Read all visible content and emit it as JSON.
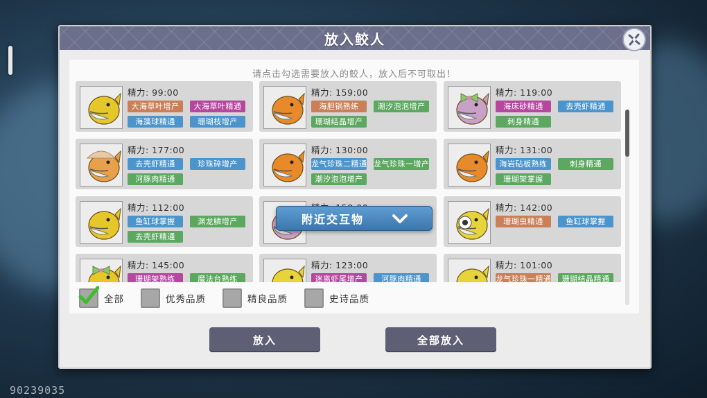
{
  "dialog": {
    "title": "放入鲛人",
    "hint": "请点击勾选需要放入的鲛人，放入后不可取出！"
  },
  "energy_label": "精力:",
  "cards": [
    {
      "energy": "99:00",
      "fish_color": "#e6c72a",
      "accessory": "none",
      "tags": [
        {
          "text": "大海草叶增产",
          "color": "orange"
        },
        {
          "text": "大海草叶精通",
          "color": "pink"
        },
        {
          "text": "海藻球精通",
          "color": "blue"
        },
        {
          "text": "珊瑚枝增产",
          "color": "blue"
        }
      ]
    },
    {
      "energy": "159:00",
      "fish_color": "#e88a2a",
      "accessory": "none",
      "tags": [
        {
          "text": "海胆锅熟练",
          "color": "orange"
        },
        {
          "text": "潮汐泡泡增产",
          "color": "green"
        },
        {
          "text": "珊瑚结晶增产",
          "color": "green"
        }
      ]
    },
    {
      "energy": "119:00",
      "fish_color": "#c8a0c8",
      "accessory": "bow",
      "tags": [
        {
          "text": "海床砂精通",
          "color": "pink"
        },
        {
          "text": "去壳虾精通",
          "color": "blue"
        },
        {
          "text": "刺身精通",
          "color": "green"
        }
      ]
    },
    {
      "energy": "177:00",
      "fish_color": "#e8a04a",
      "accessory": "shell",
      "tags": [
        {
          "text": "去壳虾精通",
          "color": "blue"
        },
        {
          "text": "珍珠碎增产",
          "color": "blue"
        },
        {
          "text": "河豚肉精通",
          "color": "green"
        }
      ]
    },
    {
      "energy": "130:00",
      "fish_color": "#e88a2a",
      "accessory": "none",
      "tags": [
        {
          "text": "龙气珍珠二精通",
          "color": "blue"
        },
        {
          "text": "龙气珍珠一增产",
          "color": "green"
        },
        {
          "text": "潮汐泡泡增产",
          "color": "green"
        }
      ]
    },
    {
      "energy": "131:00",
      "fish_color": "#e88a2a",
      "accessory": "none",
      "tags": [
        {
          "text": "海岩砧板熟练",
          "color": "blue"
        },
        {
          "text": "刺身精通",
          "color": "green"
        },
        {
          "text": "珊瑚架掌握",
          "color": "green"
        }
      ]
    },
    {
      "energy": "112:00",
      "fish_color": "#e6c72a",
      "accessory": "none",
      "tags": [
        {
          "text": "鱼缸球掌握",
          "color": "blue"
        },
        {
          "text": "渊龙鳞增产",
          "color": "green"
        },
        {
          "text": "去壳虾精通",
          "color": "green"
        }
      ]
    },
    {
      "energy": "158:00",
      "fish_color": "#c8a0c8",
      "accessory": "none",
      "tags": []
    },
    {
      "energy": "142:00",
      "fish_color": "#e6d43a",
      "accessory": "eye",
      "tags": [
        {
          "text": "珊瑚虫精通",
          "color": "orange"
        },
        {
          "text": "鱼缸球掌握",
          "color": "blue"
        }
      ]
    },
    {
      "energy": "145:00",
      "fish_color": "#e6c72a",
      "accessory": "bow",
      "tags": [
        {
          "text": "珊瑚架熟练",
          "color": "pink"
        },
        {
          "text": "魔法台熟练",
          "color": "green"
        }
      ]
    },
    {
      "energy": "123:00",
      "fish_color": "#e6d43a",
      "accessory": "none",
      "tags": [
        {
          "text": "迷离虾尾增产",
          "color": "pink"
        },
        {
          "text": "河豚肉精通",
          "color": "blue"
        }
      ]
    },
    {
      "energy": "101:00",
      "fish_color": "#e6d43a",
      "accessory": "none",
      "tags": [
        {
          "text": "龙气珍珠一精通",
          "color": "orange"
        },
        {
          "text": "珊瑚结晶精通",
          "color": "green"
        }
      ]
    }
  ],
  "filters": [
    {
      "label": "全部",
      "checked": true
    },
    {
      "label": "优秀品质",
      "checked": false
    },
    {
      "label": "精良品质",
      "checked": false
    },
    {
      "label": "史诗品质",
      "checked": false
    }
  ],
  "buttons": {
    "put_in": "放入",
    "put_all": "全部放入"
  },
  "nearby": {
    "label": "附近交互物"
  },
  "player_id": "90239035",
  "colors": {
    "orange": "#c97f57",
    "blue": "#4c95cc",
    "green": "#5ca860",
    "pink": "#b6479f",
    "title_bar": "#6b6f8b",
    "button": "#5e5f74"
  }
}
